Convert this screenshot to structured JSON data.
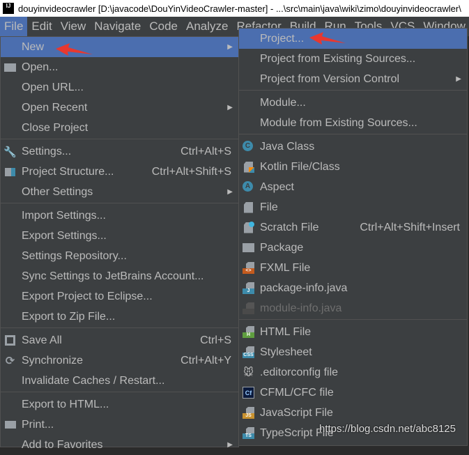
{
  "title": "douyinvideocrawler [D:\\javacode\\DouYinVideoCrawler-master] - ...\\src\\main\\java\\wiki\\zimo\\douyinvideocrawler\\",
  "logo": "IJ",
  "menubar": [
    "File",
    "Edit",
    "View",
    "Navigate",
    "Code",
    "Analyze",
    "Refactor",
    "Build",
    "Run",
    "Tools",
    "VCS",
    "Window"
  ],
  "file_menu": [
    {
      "label": "New",
      "arrow": true,
      "sel": true
    },
    {
      "label": "Open...",
      "icon": "folder-icon"
    },
    {
      "label": "Open URL..."
    },
    {
      "label": "Open Recent",
      "arrow": true
    },
    {
      "label": "Close Project"
    },
    {
      "sep": true
    },
    {
      "label": "Settings...",
      "shortcut": "Ctrl+Alt+S",
      "icon": "wrench-icon"
    },
    {
      "label": "Project Structure...",
      "shortcut": "Ctrl+Alt+Shift+S",
      "icon": "project-structure-icon"
    },
    {
      "label": "Other Settings",
      "arrow": true
    },
    {
      "sep": true
    },
    {
      "label": "Import Settings..."
    },
    {
      "label": "Export Settings..."
    },
    {
      "label": "Settings Repository..."
    },
    {
      "label": "Sync Settings to JetBrains Account..."
    },
    {
      "label": "Export Project to Eclipse..."
    },
    {
      "label": "Export to Zip File..."
    },
    {
      "sep": true
    },
    {
      "label": "Save All",
      "shortcut": "Ctrl+S",
      "icon": "save-icon"
    },
    {
      "label": "Synchronize",
      "shortcut": "Ctrl+Alt+Y",
      "icon": "sync-icon"
    },
    {
      "label": "Invalidate Caches / Restart..."
    },
    {
      "sep": true
    },
    {
      "label": "Export to HTML..."
    },
    {
      "label": "Print...",
      "icon": "print-icon"
    },
    {
      "label": "Add to Favorites",
      "arrow": true
    }
  ],
  "new_menu": [
    {
      "label": "Project...",
      "sel": true
    },
    {
      "label": "Project from Existing Sources..."
    },
    {
      "label": "Project from Version Control",
      "arrow": true
    },
    {
      "sep": true
    },
    {
      "label": "Module..."
    },
    {
      "label": "Module from Existing Sources..."
    },
    {
      "sep": true
    },
    {
      "label": "Java Class",
      "icon": "java-class-icon"
    },
    {
      "label": "Kotlin File/Class",
      "icon": "kotlin-file-icon"
    },
    {
      "label": "Aspect",
      "icon": "aspect-icon"
    },
    {
      "label": "File",
      "icon": "file-icon"
    },
    {
      "label": "Scratch File",
      "shortcut": "Ctrl+Alt+Shift+Insert",
      "icon": "scratch-file-icon"
    },
    {
      "label": "Package",
      "icon": "package-icon"
    },
    {
      "label": "FXML File",
      "icon": "fxml-file-icon"
    },
    {
      "label": "package-info.java",
      "icon": "package-info-icon"
    },
    {
      "label": "module-info.java",
      "icon": "module-info-icon",
      "disabled": true
    },
    {
      "sep": true
    },
    {
      "label": "HTML File",
      "icon": "html-file-icon"
    },
    {
      "label": "Stylesheet",
      "icon": "stylesheet-icon"
    },
    {
      "label": ".editorconfig file",
      "icon": "editorconfig-icon"
    },
    {
      "label": "CFML/CFC file",
      "icon": "cfml-icon"
    },
    {
      "label": "JavaScript File",
      "icon": "javascript-file-icon"
    },
    {
      "label": "TypeScript File",
      "icon": "typescript-file-icon"
    }
  ],
  "watermark": "https://blog.csdn.net/abc8125",
  "colors": {
    "menu_bg": "#3c3f41",
    "highlight": "#4b6eaf",
    "text": "#bbbbbb",
    "arrow": "#e8382f"
  }
}
